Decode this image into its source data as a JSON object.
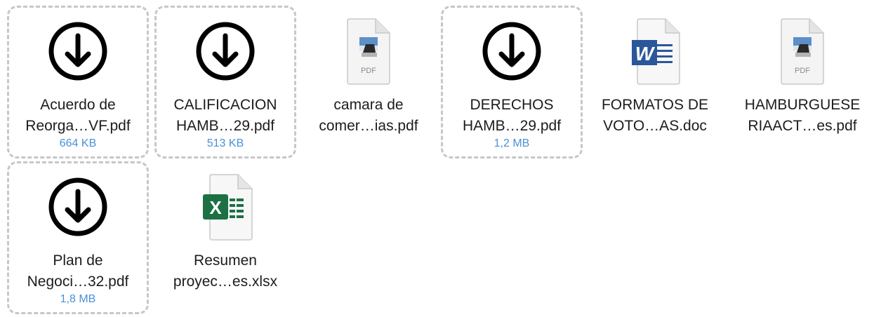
{
  "files": [
    {
      "line1": "Acuerdo de",
      "line2": "Reorga…VF.pdf",
      "size": "664 KB",
      "icon": "download-circle-icon"
    },
    {
      "line1": "CALIFICACION",
      "line2": "HAMB…29.pdf",
      "size": "513 KB",
      "icon": "download-circle-icon"
    },
    {
      "line1": "camara de",
      "line2": "comer…ias.pdf",
      "size": "",
      "icon": "pdf-file-icon"
    },
    {
      "line1": "DERECHOS",
      "line2": "HAMB…29.pdf",
      "size": "1,2 MB",
      "icon": "download-circle-icon"
    },
    {
      "line1": "FORMATOS DE",
      "line2": "VOTO…AS.doc",
      "size": "",
      "icon": "word-doc-icon"
    },
    {
      "line1": "HAMBURGUESE",
      "line2": "RIAACT…es.pdf",
      "size": "",
      "icon": "pdf-file-icon"
    },
    {
      "line1": "Plan de",
      "line2": "Negoci…32.pdf",
      "size": "1,8 MB",
      "icon": "download-circle-icon"
    },
    {
      "line1": "Resumen",
      "line2": "proyec…es.xlsx",
      "size": "",
      "icon": "excel-sheet-icon"
    }
  ],
  "icons": {
    "pdf_label": "PDF",
    "word_letter": "W",
    "excel_letter": "X"
  },
  "colors": {
    "size_text": "#4a90d9",
    "dashed_border": "#c7c7c7",
    "word_blue": "#2b579a",
    "excel_green": "#1d7044"
  }
}
